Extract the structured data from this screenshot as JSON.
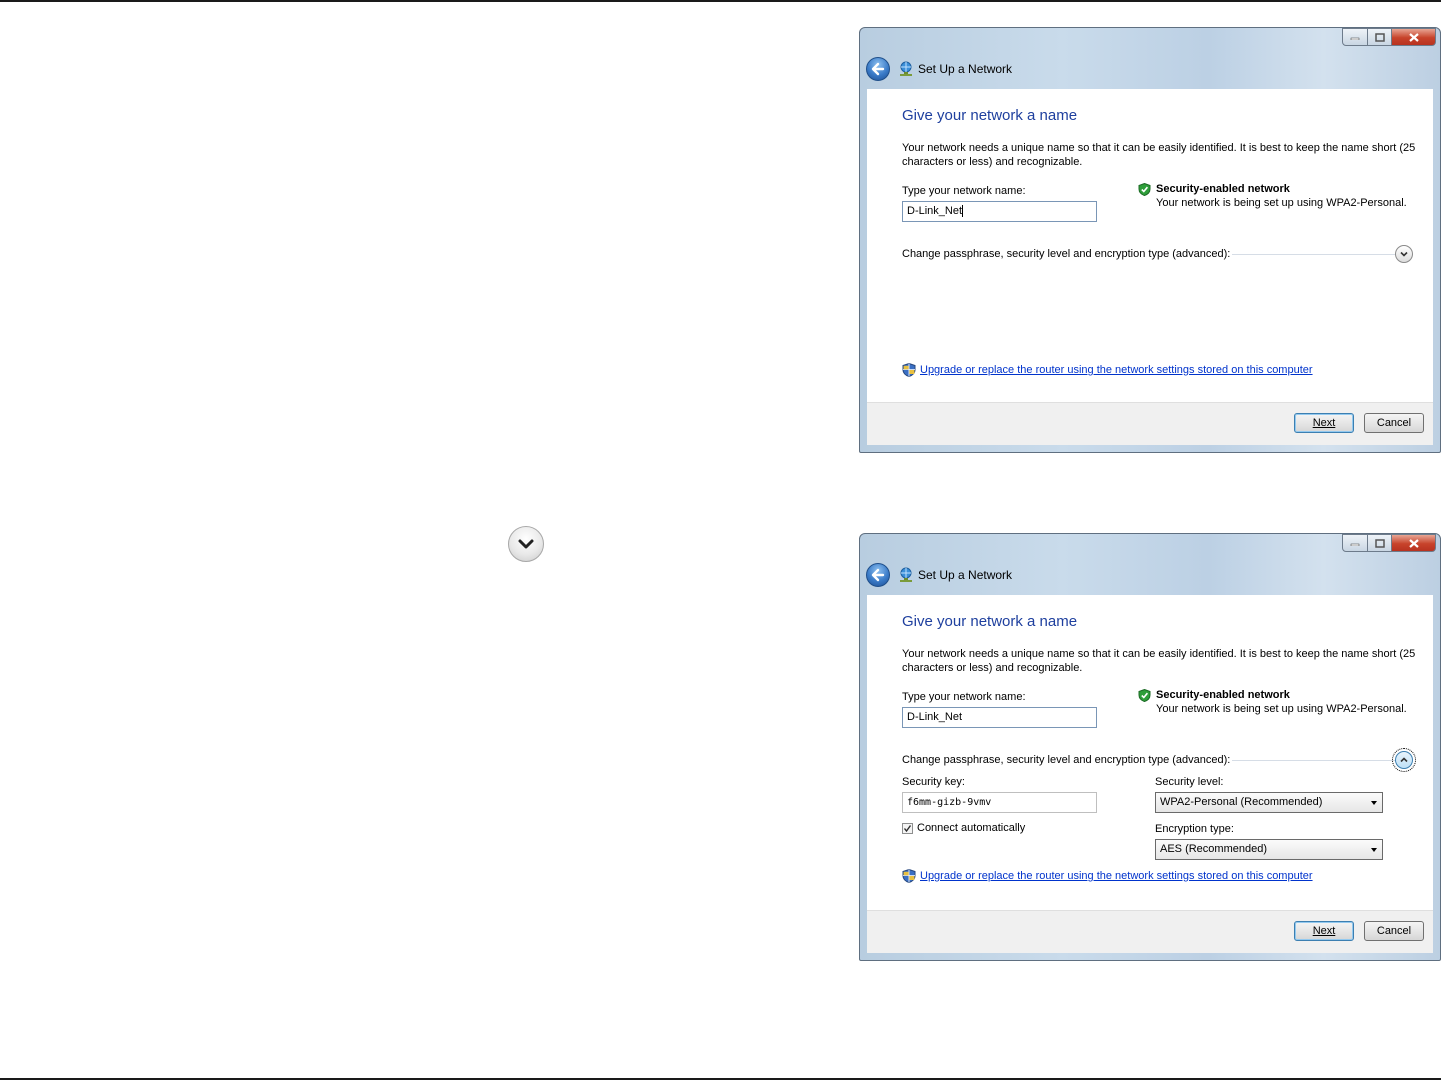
{
  "window_title": "Set Up a Network",
  "heading": "Give your network a name",
  "description": "Your network needs a unique name so that it can be easily identified. It is best to keep the name short (25 characters or less) and recognizable.",
  "network_name_label": "Type your network name:",
  "network_name_value": "D-Link_Net",
  "security_title": "Security-enabled network",
  "security_desc": "Your network is being set up using WPA2-Personal.",
  "advanced_label": "Change passphrase, security level and encryption type (advanced):",
  "upgrade_link": "Upgrade or replace the router using the network settings stored on this computer",
  "next_button": "Next",
  "cancel_button": "Cancel",
  "advanced": {
    "security_key_label": "Security key:",
    "security_key_value": "f6mm-gizb-9vmv",
    "connect_auto_label": "Connect automatically",
    "connect_auto_checked": true,
    "security_level_label": "Security level:",
    "security_level_value": "WPA2-Personal (Recommended)",
    "encryption_type_label": "Encryption type:",
    "encryption_type_value": "AES (Recommended)"
  },
  "icons": {
    "expand": "chevron-down-icon",
    "collapse": "chevron-up-icon",
    "back": "back-arrow-icon",
    "network": "network-icon",
    "shield": "shield-check-icon",
    "uac": "uac-shield-icon"
  },
  "colors": {
    "heading": "#1e3f9e",
    "link": "#0033cc",
    "shield_ok": "#2e9e3a"
  }
}
